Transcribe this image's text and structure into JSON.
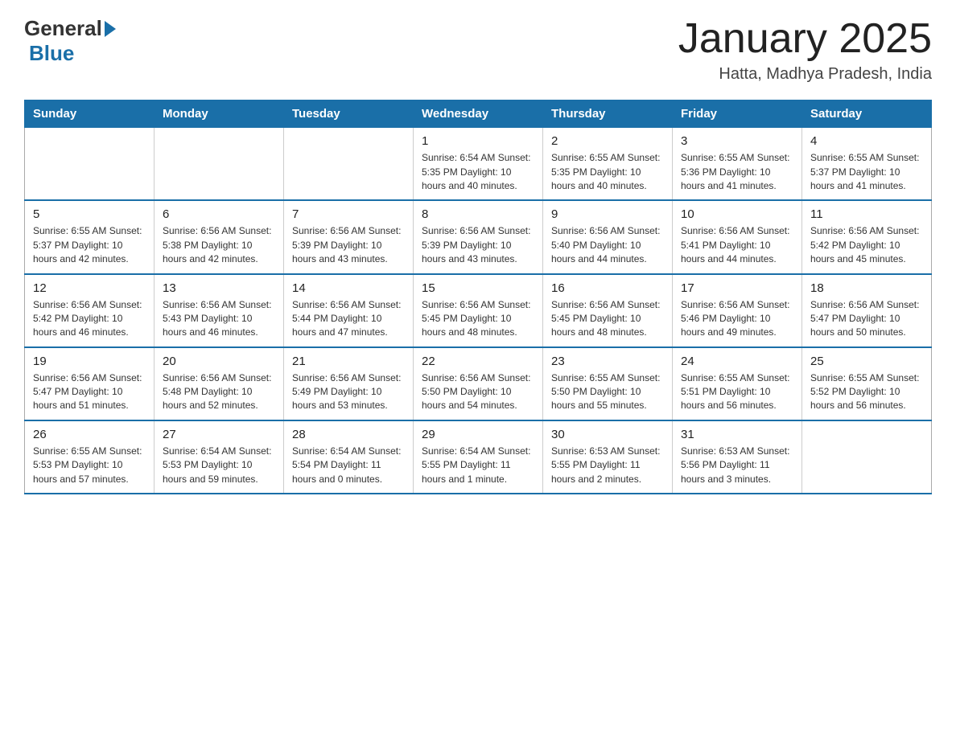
{
  "header": {
    "logo_general": "General",
    "logo_blue": "Blue",
    "title": "January 2025",
    "subtitle": "Hatta, Madhya Pradesh, India"
  },
  "days_of_week": [
    "Sunday",
    "Monday",
    "Tuesday",
    "Wednesday",
    "Thursday",
    "Friday",
    "Saturday"
  ],
  "weeks": [
    [
      {
        "day": "",
        "info": ""
      },
      {
        "day": "",
        "info": ""
      },
      {
        "day": "",
        "info": ""
      },
      {
        "day": "1",
        "info": "Sunrise: 6:54 AM\nSunset: 5:35 PM\nDaylight: 10 hours\nand 40 minutes."
      },
      {
        "day": "2",
        "info": "Sunrise: 6:55 AM\nSunset: 5:35 PM\nDaylight: 10 hours\nand 40 minutes."
      },
      {
        "day": "3",
        "info": "Sunrise: 6:55 AM\nSunset: 5:36 PM\nDaylight: 10 hours\nand 41 minutes."
      },
      {
        "day": "4",
        "info": "Sunrise: 6:55 AM\nSunset: 5:37 PM\nDaylight: 10 hours\nand 41 minutes."
      }
    ],
    [
      {
        "day": "5",
        "info": "Sunrise: 6:55 AM\nSunset: 5:37 PM\nDaylight: 10 hours\nand 42 minutes."
      },
      {
        "day": "6",
        "info": "Sunrise: 6:56 AM\nSunset: 5:38 PM\nDaylight: 10 hours\nand 42 minutes."
      },
      {
        "day": "7",
        "info": "Sunrise: 6:56 AM\nSunset: 5:39 PM\nDaylight: 10 hours\nand 43 minutes."
      },
      {
        "day": "8",
        "info": "Sunrise: 6:56 AM\nSunset: 5:39 PM\nDaylight: 10 hours\nand 43 minutes."
      },
      {
        "day": "9",
        "info": "Sunrise: 6:56 AM\nSunset: 5:40 PM\nDaylight: 10 hours\nand 44 minutes."
      },
      {
        "day": "10",
        "info": "Sunrise: 6:56 AM\nSunset: 5:41 PM\nDaylight: 10 hours\nand 44 minutes."
      },
      {
        "day": "11",
        "info": "Sunrise: 6:56 AM\nSunset: 5:42 PM\nDaylight: 10 hours\nand 45 minutes."
      }
    ],
    [
      {
        "day": "12",
        "info": "Sunrise: 6:56 AM\nSunset: 5:42 PM\nDaylight: 10 hours\nand 46 minutes."
      },
      {
        "day": "13",
        "info": "Sunrise: 6:56 AM\nSunset: 5:43 PM\nDaylight: 10 hours\nand 46 minutes."
      },
      {
        "day": "14",
        "info": "Sunrise: 6:56 AM\nSunset: 5:44 PM\nDaylight: 10 hours\nand 47 minutes."
      },
      {
        "day": "15",
        "info": "Sunrise: 6:56 AM\nSunset: 5:45 PM\nDaylight: 10 hours\nand 48 minutes."
      },
      {
        "day": "16",
        "info": "Sunrise: 6:56 AM\nSunset: 5:45 PM\nDaylight: 10 hours\nand 48 minutes."
      },
      {
        "day": "17",
        "info": "Sunrise: 6:56 AM\nSunset: 5:46 PM\nDaylight: 10 hours\nand 49 minutes."
      },
      {
        "day": "18",
        "info": "Sunrise: 6:56 AM\nSunset: 5:47 PM\nDaylight: 10 hours\nand 50 minutes."
      }
    ],
    [
      {
        "day": "19",
        "info": "Sunrise: 6:56 AM\nSunset: 5:47 PM\nDaylight: 10 hours\nand 51 minutes."
      },
      {
        "day": "20",
        "info": "Sunrise: 6:56 AM\nSunset: 5:48 PM\nDaylight: 10 hours\nand 52 minutes."
      },
      {
        "day": "21",
        "info": "Sunrise: 6:56 AM\nSunset: 5:49 PM\nDaylight: 10 hours\nand 53 minutes."
      },
      {
        "day": "22",
        "info": "Sunrise: 6:56 AM\nSunset: 5:50 PM\nDaylight: 10 hours\nand 54 minutes."
      },
      {
        "day": "23",
        "info": "Sunrise: 6:55 AM\nSunset: 5:50 PM\nDaylight: 10 hours\nand 55 minutes."
      },
      {
        "day": "24",
        "info": "Sunrise: 6:55 AM\nSunset: 5:51 PM\nDaylight: 10 hours\nand 56 minutes."
      },
      {
        "day": "25",
        "info": "Sunrise: 6:55 AM\nSunset: 5:52 PM\nDaylight: 10 hours\nand 56 minutes."
      }
    ],
    [
      {
        "day": "26",
        "info": "Sunrise: 6:55 AM\nSunset: 5:53 PM\nDaylight: 10 hours\nand 57 minutes."
      },
      {
        "day": "27",
        "info": "Sunrise: 6:54 AM\nSunset: 5:53 PM\nDaylight: 10 hours\nand 59 minutes."
      },
      {
        "day": "28",
        "info": "Sunrise: 6:54 AM\nSunset: 5:54 PM\nDaylight: 11 hours\nand 0 minutes."
      },
      {
        "day": "29",
        "info": "Sunrise: 6:54 AM\nSunset: 5:55 PM\nDaylight: 11 hours\nand 1 minute."
      },
      {
        "day": "30",
        "info": "Sunrise: 6:53 AM\nSunset: 5:55 PM\nDaylight: 11 hours\nand 2 minutes."
      },
      {
        "day": "31",
        "info": "Sunrise: 6:53 AM\nSunset: 5:56 PM\nDaylight: 11 hours\nand 3 minutes."
      },
      {
        "day": "",
        "info": ""
      }
    ]
  ]
}
